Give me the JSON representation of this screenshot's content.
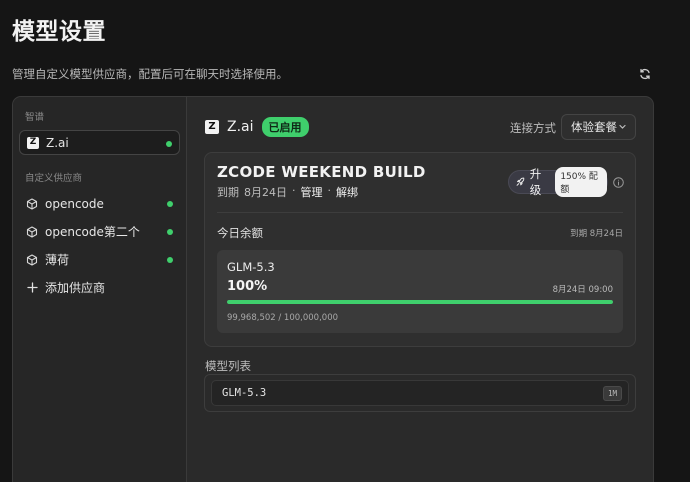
{
  "page": {
    "title": "模型设置",
    "description": "管理自定义模型供应商，配置后可在聊天时选择使用。"
  },
  "sidebar": {
    "section_official": "智谱",
    "official_item": {
      "label": "Z.ai",
      "logo": "Z",
      "status": "enabled"
    },
    "section_custom": "自定义供应商",
    "custom_items": [
      {
        "label": "opencode",
        "icon": "cube-icon",
        "status": "enabled"
      },
      {
        "label": "opencode第二个",
        "icon": "cube-icon",
        "status": "enabled"
      },
      {
        "label": "薄荷",
        "icon": "cube-icon",
        "status": "enabled"
      }
    ],
    "add_label": "添加供应商"
  },
  "provider": {
    "logo": "Z",
    "name": "Z.ai",
    "status_badge": "已启用",
    "connection_label": "连接方式",
    "connection_value": "体验套餐"
  },
  "plan": {
    "title": "ZCODE WEEKEND BUILD",
    "expire_prefix": "到期",
    "expire_date": "8月24日",
    "sep": "·",
    "manage": "管理",
    "unbind": "解绑",
    "upgrade_label": "升级",
    "quota_pill": "150% 配额",
    "today_label": "今日余额",
    "today_expire": "到期 8月24日",
    "usage": {
      "model": "GLM-5.3",
      "percent_text": "100%",
      "remaining_fraction": 1.0,
      "reset_time": "8月24日 09:00",
      "count_text": "99,968,502 / 100,000,000"
    }
  },
  "models": {
    "label": "模型列表",
    "items": [
      {
        "name": "GLM-5.3",
        "tag": "1M"
      }
    ]
  },
  "colors": {
    "accent_green": "#3fcf6c",
    "background": "#151515",
    "panel": "#2a2a2a"
  }
}
